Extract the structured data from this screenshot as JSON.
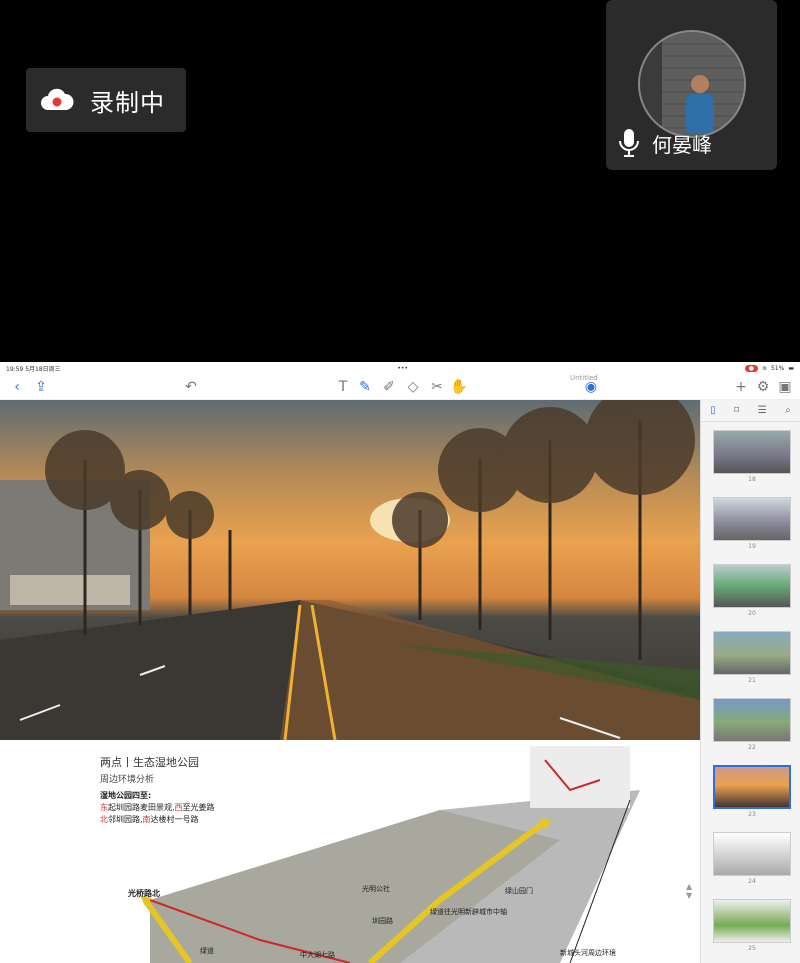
{
  "recording": {
    "label": "录制中",
    "icon": "cloud-record-icon"
  },
  "participant": {
    "name": "何晏峰",
    "mic_icon": "microphone-icon"
  },
  "ipad": {
    "status": {
      "time_date": "19:59  5月18日周三",
      "dots": "•••",
      "battery": "51%"
    },
    "toolbar": {
      "doc_title": "Untitled"
    },
    "slide2": {
      "title": "两点丨生态湿地公园",
      "subtitle": "周边环境分析",
      "heading": "湿地公园四至:",
      "line1_parts": [
        "东",
        "起圳园路麦田景观,",
        "西",
        "至光姜路"
      ],
      "line2_parts": [
        "北",
        "邻圳园路,",
        "南",
        "达楼村一号路"
      ],
      "labels": {
        "road_north": "光桥路北",
        "yard": "光明公社",
        "park": "圳园路",
        "road_low": "中大湖七路",
        "station": "绿道",
        "landmark": "绿山园门",
        "banner": "绿道往光明新辟城市中轴",
        "caption": "新城头河周边环境"
      }
    },
    "sidebar": {
      "thumb_numbers": [
        "18",
        "19",
        "20",
        "21",
        "22",
        "23",
        "24",
        "25"
      ],
      "selected_index": 5
    }
  },
  "colors": {
    "accent": "#2f6fd8",
    "record_red": "#e53935",
    "tile_bg": "#2b2b2b"
  }
}
